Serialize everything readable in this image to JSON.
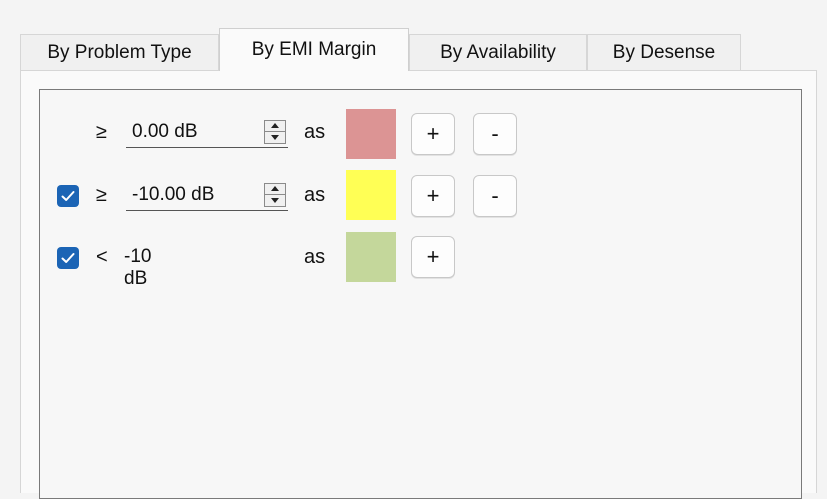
{
  "tabs": [
    {
      "label": "By Problem Type",
      "active": false
    },
    {
      "label": "By EMI Margin",
      "active": true
    },
    {
      "label": "By Availability",
      "active": false
    },
    {
      "label": "By Desense",
      "active": false
    }
  ],
  "rows": [
    {
      "checked": null,
      "comparator": "≥",
      "value": "0.00 dB",
      "as_label": "as",
      "color": "#dc9494",
      "add_label": "+",
      "remove_label": "-"
    },
    {
      "checked": true,
      "comparator": "≥",
      "value": "-10.00 dB",
      "as_label": "as",
      "color": "#ffff55",
      "add_label": "+",
      "remove_label": "-"
    },
    {
      "checked": true,
      "comparator": "<",
      "value": "-10 dB",
      "as_label": "as",
      "color": "#c4d79b",
      "add_label": "+"
    }
  ],
  "colors": {
    "checkbox_accent": "#1b64b5"
  }
}
